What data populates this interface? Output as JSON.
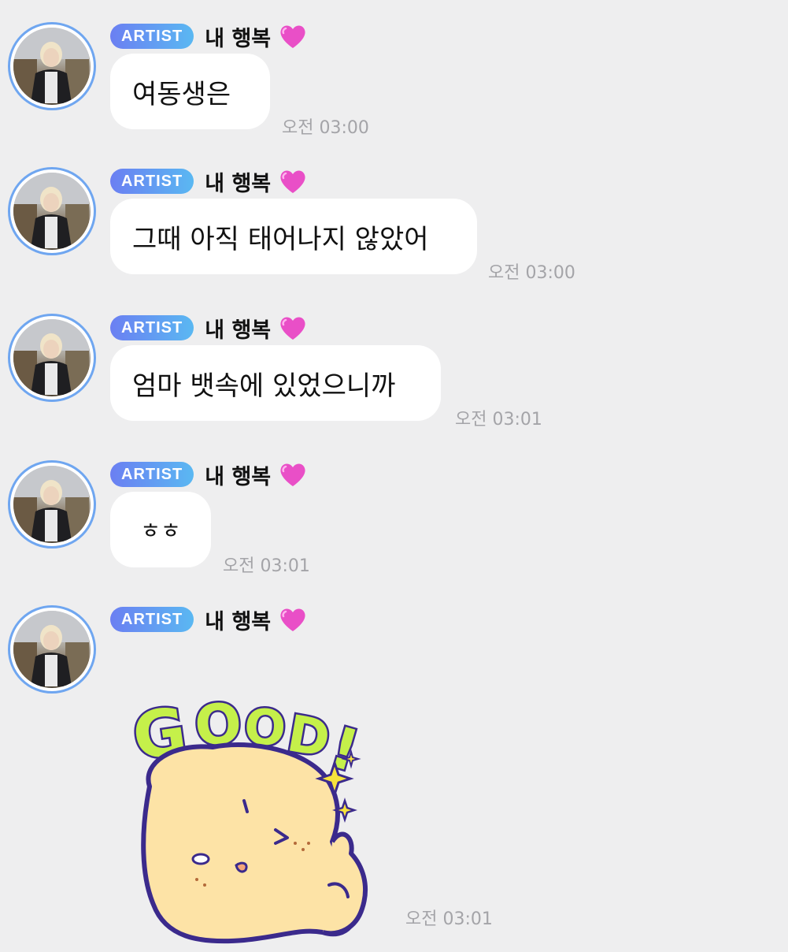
{
  "messages": [
    {
      "badge": "ARTIST",
      "sender": "내 행복",
      "text": "여동생은",
      "time": "오전 03:00"
    },
    {
      "badge": "ARTIST",
      "sender": "내 행복",
      "text": "그때 아직 태어나지 않았어",
      "time": "오전 03:00"
    },
    {
      "badge": "ARTIST",
      "sender": "내 행복",
      "text": "엄마 뱃속에 있었으니까",
      "time": "오전 03:01"
    },
    {
      "badge": "ARTIST",
      "sender": "내 행복",
      "text": "ㅎㅎ",
      "time": "오전 03:01"
    },
    {
      "badge": "ARTIST",
      "sender": "내 행복",
      "sticker_text": "GOOD!",
      "time": "오전 03:01"
    }
  ],
  "icons": {
    "heart": "purple-heart-emoji",
    "avatar": "artist-profile-photo"
  },
  "colors": {
    "background": "#eeeeef",
    "badge_start": "#6b7ff2",
    "badge_end": "#5ab8f2",
    "avatar_ring": "#6fa6f0",
    "heart": "#e94fc7",
    "timestamp": "#a4a4a8"
  }
}
